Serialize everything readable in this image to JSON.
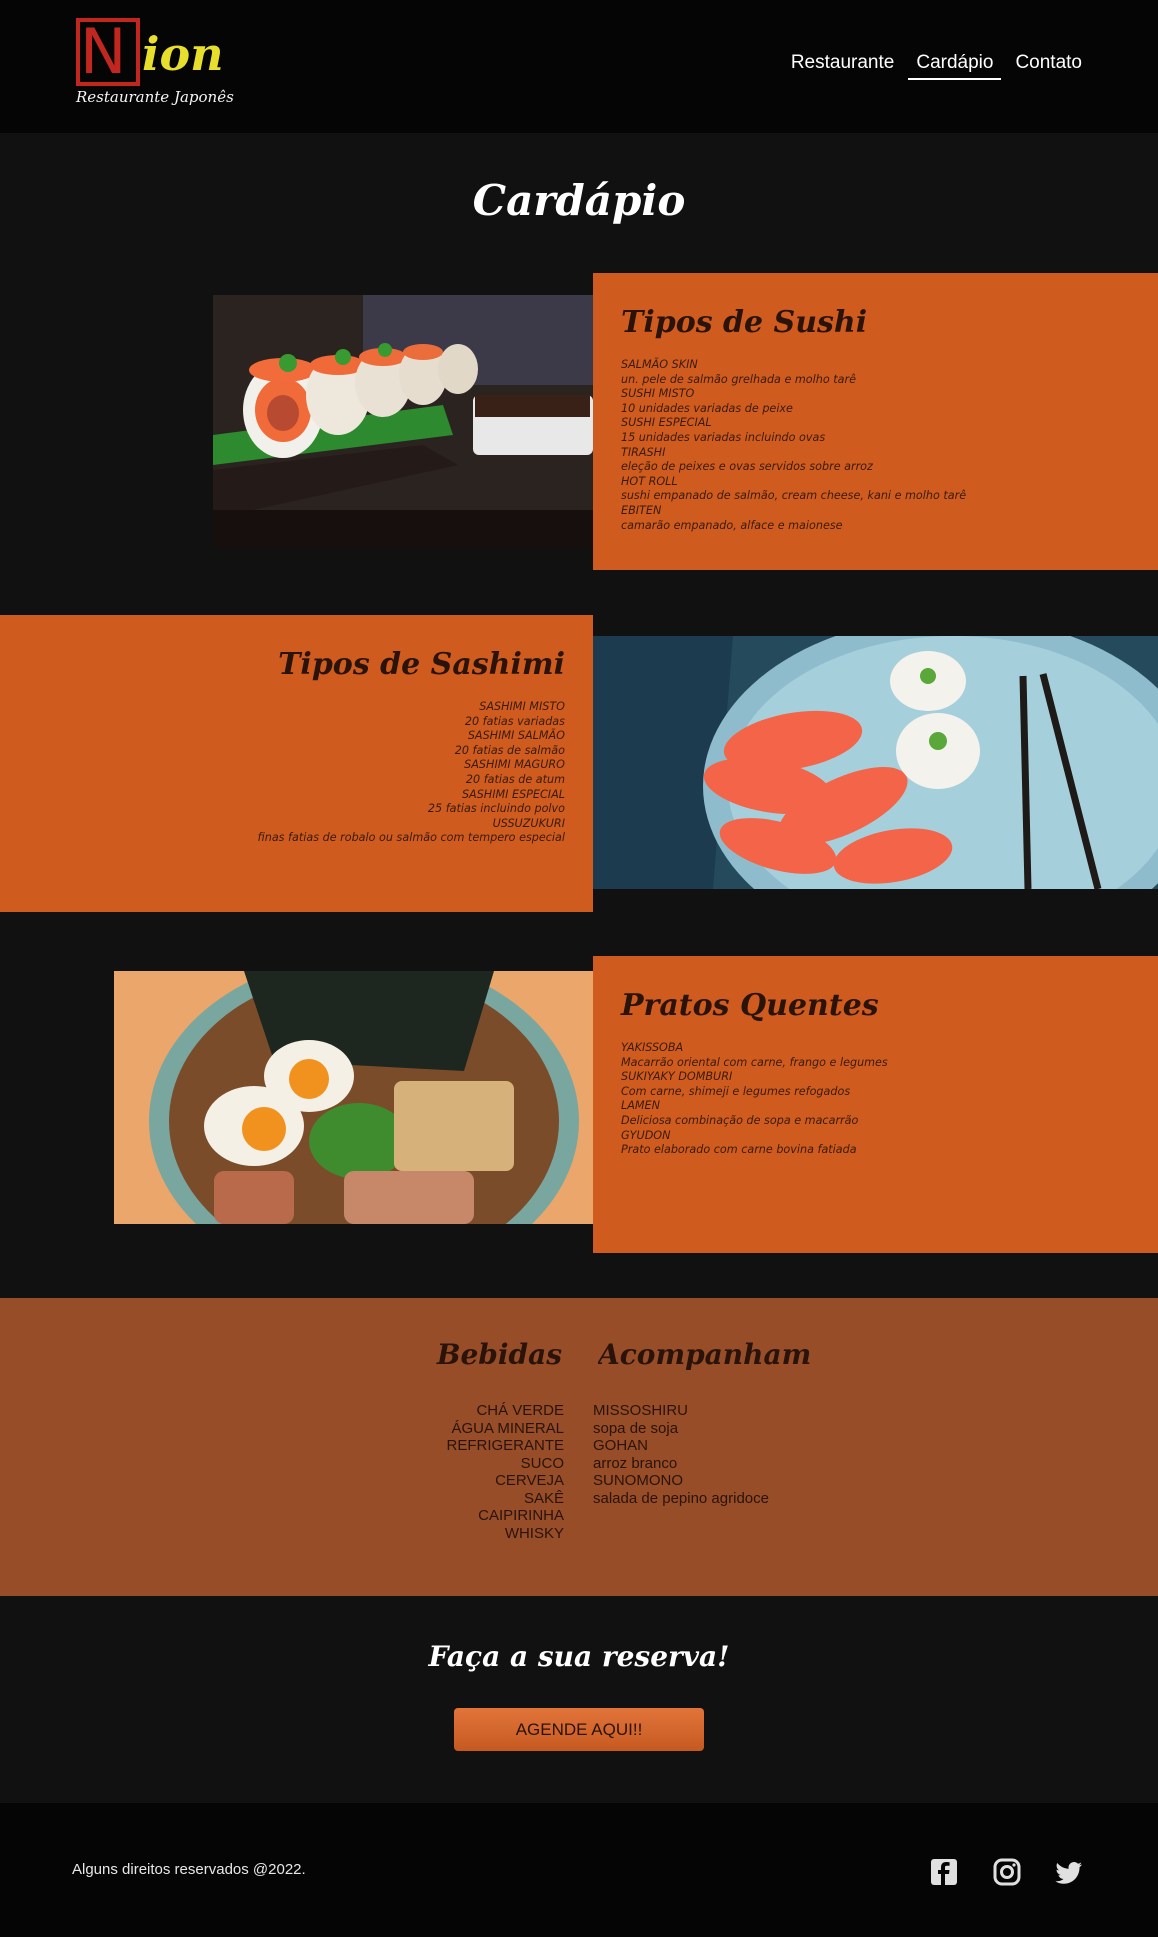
{
  "header": {
    "logo_letter": "N",
    "logo_word": "ion",
    "logo_sub": "Restaurante Japonês",
    "nav": [
      {
        "label": "Restaurante"
      },
      {
        "label": "Cardápio"
      },
      {
        "label": "Contato"
      }
    ]
  },
  "page_title": "Cardápio",
  "sections": {
    "sushi": {
      "title": "Tipos de Sushi",
      "items": [
        "SALMÃO SKIN",
        "un. pele de salmão grelhada e molho tarê",
        "SUSHI MISTO",
        "10 unidades variadas de peixe",
        "SUSHI ESPECIAL",
        "15 unidades variadas incluindo ovas",
        "TIRASHI",
        "eleção de peixes e ovas servidos sobre arroz",
        "HOT ROLL",
        "sushi empanado de salmão, cream cheese, kani e molho tarê",
        "EBITEN",
        "camarão empanado, alface e maionese"
      ]
    },
    "sashimi": {
      "title": "Tipos de Sashimi",
      "items": [
        "SASHIMI MISTO",
        "20 fatias variadas",
        "SASHIMI SALMÃO",
        "20 fatias de salmão",
        "SASHIMI MAGURO",
        "20 fatias de atum",
        "SASHIMI ESPECIAL",
        "25 fatias incluindo polvo",
        "USSUZUKURI",
        "finas fatias de robalo ou salmão com tempero especial"
      ]
    },
    "hot": {
      "title": "Pratos Quentes",
      "items": [
        "YAKISSOBA",
        "Macarrão oriental com carne, frango e legumes",
        "SUKIYAKY DOMBURI",
        "Com carne, shimeji e legumes refogados",
        "LAMEN",
        "Deliciosa combinação de sopa e macarrão",
        "GYUDON",
        "Prato elaborado com carne bovina fatiada"
      ]
    }
  },
  "drinks": {
    "title": "Bebidas",
    "items": [
      "CHÁ VERDE",
      "ÁGUA MINERAL",
      "REFRIGERANTE",
      "SUCO",
      "CERVEJA",
      "SAKÊ",
      "CAIPIRINHA",
      "WHISKY"
    ]
  },
  "sides": {
    "title": "Acompanhamento",
    "items": [
      "MISSOSHIRU",
      "sopa de soja",
      "GOHAN",
      "arroz branco",
      "SUNOMONO",
      "salada de pepino agridoce"
    ]
  },
  "reserve": {
    "title": "Faça a sua reserva!",
    "button": "AGENDE AQUI!!"
  },
  "footer": {
    "text": "Alguns direitos reservados @2022.",
    "icons": [
      "facebook-icon",
      "instagram-icon",
      "twitter-icon"
    ]
  },
  "colors": {
    "panel": "#cf5c1e",
    "drinks_bg": "#974d27",
    "logo_red": "#c1271f",
    "logo_yellow": "#e8df2c"
  }
}
